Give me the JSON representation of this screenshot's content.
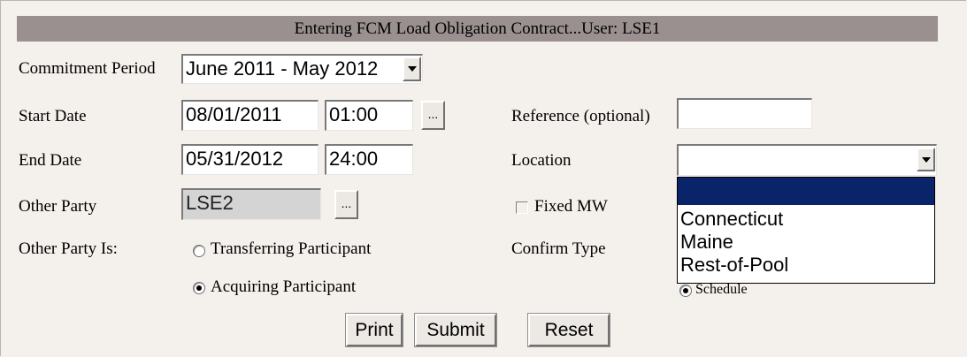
{
  "header": {
    "title": "Entering FCM Load Obligation Contract...User: LSE1"
  },
  "form": {
    "commitment_period": {
      "label": "Commitment Period",
      "value": "June 2011 - May 2012"
    },
    "start_date": {
      "label": "Start Date",
      "date": "08/01/2011",
      "time": "01:00",
      "picker": "..."
    },
    "end_date": {
      "label": "End Date",
      "date": "05/31/2012",
      "time": "24:00"
    },
    "other_party": {
      "label": "Other Party",
      "value": "LSE2",
      "picker": "..."
    },
    "other_party_is": {
      "label": "Other Party Is:",
      "options": [
        "Transferring Participant",
        "Acquiring Participant"
      ],
      "selected": "Acquiring Participant"
    },
    "reference": {
      "label": "Reference (optional)",
      "value": ""
    },
    "location": {
      "label": "Location",
      "value": "",
      "options": [
        "",
        "Connecticut",
        "Maine",
        "Rest-of-Pool"
      ]
    },
    "fixed_mw": {
      "label": "Fixed MW",
      "checked": false
    },
    "confirm_type": {
      "label": "Confirm Type",
      "visible_option": "Schedule",
      "selected": "Schedule"
    }
  },
  "buttons": {
    "print": "Print",
    "submit": "Submit",
    "reset": "Reset"
  },
  "colors": {
    "title_bar": "#9a9090",
    "background": "#f4f0ec",
    "selection": "#0a246a"
  }
}
